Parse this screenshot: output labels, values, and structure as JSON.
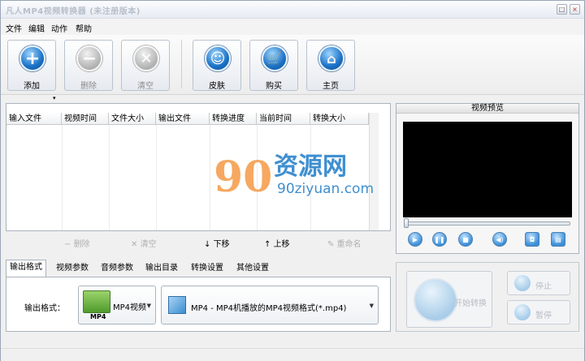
{
  "window": {
    "title": "凡人MP4视频转换器 (未注册版本)",
    "buttons": [
      "□",
      "×"
    ]
  },
  "menu": [
    "文件",
    "编辑",
    "动作",
    "帮助"
  ],
  "toolbar": [
    {
      "label": "添加",
      "icon": "plus-icon",
      "enabled": true
    },
    {
      "label": "删除",
      "icon": "minus-icon",
      "enabled": false
    },
    {
      "label": "清空",
      "icon": "clear-icon",
      "enabled": false
    },
    {
      "label": "皮肤",
      "icon": "smiley-icon",
      "enabled": true
    },
    {
      "label": "购买",
      "icon": "cart-icon",
      "enabled": true
    },
    {
      "label": "主页",
      "icon": "home-icon",
      "enabled": true
    }
  ],
  "table": {
    "columns": [
      "输入文件",
      "视频时间",
      "文件大小",
      "输出文件",
      "转换进度",
      "当前时间",
      "转换大小"
    ],
    "rows": []
  },
  "watermark": {
    "logo": "90",
    "cn": "资源网",
    "en": "90ziyuan.com"
  },
  "row_actions": [
    {
      "label": "删除",
      "icon": "minus-icon",
      "enabled": false
    },
    {
      "label": "清空",
      "icon": "clear-icon",
      "enabled": false
    },
    {
      "label": "下移",
      "icon": "arrow-down-icon",
      "enabled": true
    },
    {
      "label": "上移",
      "icon": "arrow-up-icon",
      "enabled": true
    },
    {
      "label": "重命名",
      "icon": "rename-icon",
      "enabled": false
    }
  ],
  "tabs": [
    "输出格式",
    "视频参数",
    "音频参数",
    "输出目录",
    "转换设置",
    "其他设置"
  ],
  "selected_tab": "输出格式",
  "output": {
    "label": "输出格式：",
    "category": "MP4视频",
    "category_badge": "MP4",
    "format": "MP4 - MP4机播放的MP4视频格式(*.mp4)"
  },
  "preview": {
    "title": "视频预览",
    "seek_position": 0.0
  },
  "playback": [
    "play-icon",
    "pause-icon",
    "stop-icon",
    "volume-icon",
    "snapshot-icon",
    "folder-icon"
  ],
  "controls": {
    "start": "开始转换",
    "stop": "停止",
    "pause": "暂停"
  },
  "colors": {
    "accent": "#1b72c6",
    "watermark_orange": "#f59a45",
    "watermark_blue": "#3f8fd0"
  }
}
